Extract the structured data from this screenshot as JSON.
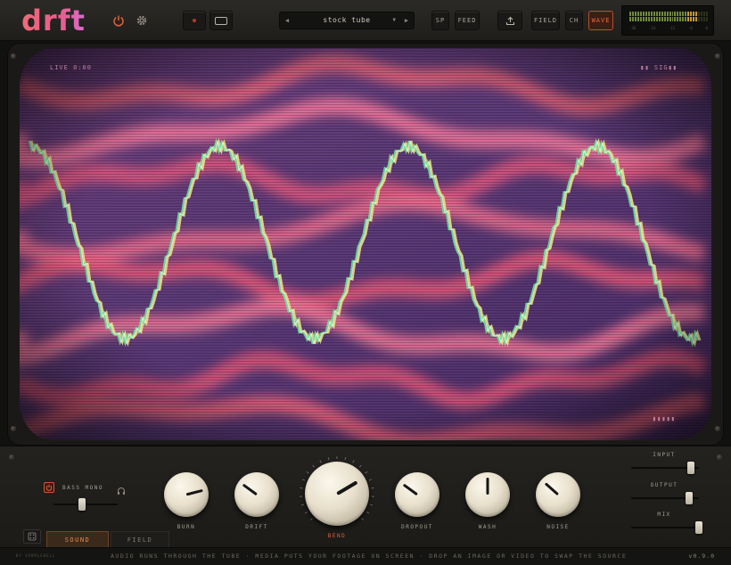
{
  "app": {
    "logo": "drft",
    "colors": {
      "accent": "#e3603a",
      "screen_pink": "#f0647c",
      "screen_purple": "#5b3a78",
      "trace_green": "#63e39b",
      "trace_yellow": "#f2e07a"
    }
  },
  "header": {
    "power_icon": "power-icon",
    "settings_icon": "gear-icon",
    "record_icon": "record-dot-icon",
    "screen_icon": "screen-rect-icon",
    "preset": {
      "name": "stock tube",
      "prev_icon": "triangle-left-icon",
      "next_icon": "triangle-right-icon",
      "dropdown_icon": "caret-down-icon"
    },
    "buttons": {
      "sp": "SP",
      "feed": "FEED",
      "field": "FIELD",
      "ch": "CH",
      "wave": "WAVE"
    },
    "export_icon": "upload-icon",
    "meter": {
      "scale": [
        "-36",
        "-24",
        "-12",
        "-6",
        "0"
      ]
    }
  },
  "screen": {
    "overlay_left": "LIVE 0:00",
    "overlay_right": "▮▮ SIG▮▮",
    "overlay_bottom": "▮▮▮▮▮"
  },
  "controls": {
    "bass_mono": {
      "label": "BASS MONO",
      "level": 0.45,
      "headphone_icon": "headphone-icon"
    },
    "knobs": [
      {
        "label": "BURN",
        "value": 0.78
      },
      {
        "label": "DRIFT",
        "value": 0.3
      },
      {
        "label": "BEND",
        "value": 0.72
      },
      {
        "label": "DROPOUT",
        "value": 0.3
      },
      {
        "label": "WASH",
        "value": 0.5
      },
      {
        "label": "NOISE",
        "value": 0.32
      }
    ],
    "input": {
      "label": "INPUT",
      "level": 0.88
    },
    "output": {
      "label": "OUTPUT",
      "level": 0.85
    },
    "mix": {
      "label": "MIX",
      "level": 1.0
    },
    "tabs": {
      "sound": "SOUND",
      "field": "FIELD"
    },
    "dice_icon": "dice-icon"
  },
  "footer": {
    "credit": "BY SAMPLEBELL",
    "hint": "AUDIO RUNS THROUGH THE TUBE  ·  MEDIA PUTS YOUR FOOTAGE ON SCREEN  ·  DROP AN IMAGE OR VIDEO TO SWAP THE SOURCE",
    "version": "v0.9.0"
  }
}
